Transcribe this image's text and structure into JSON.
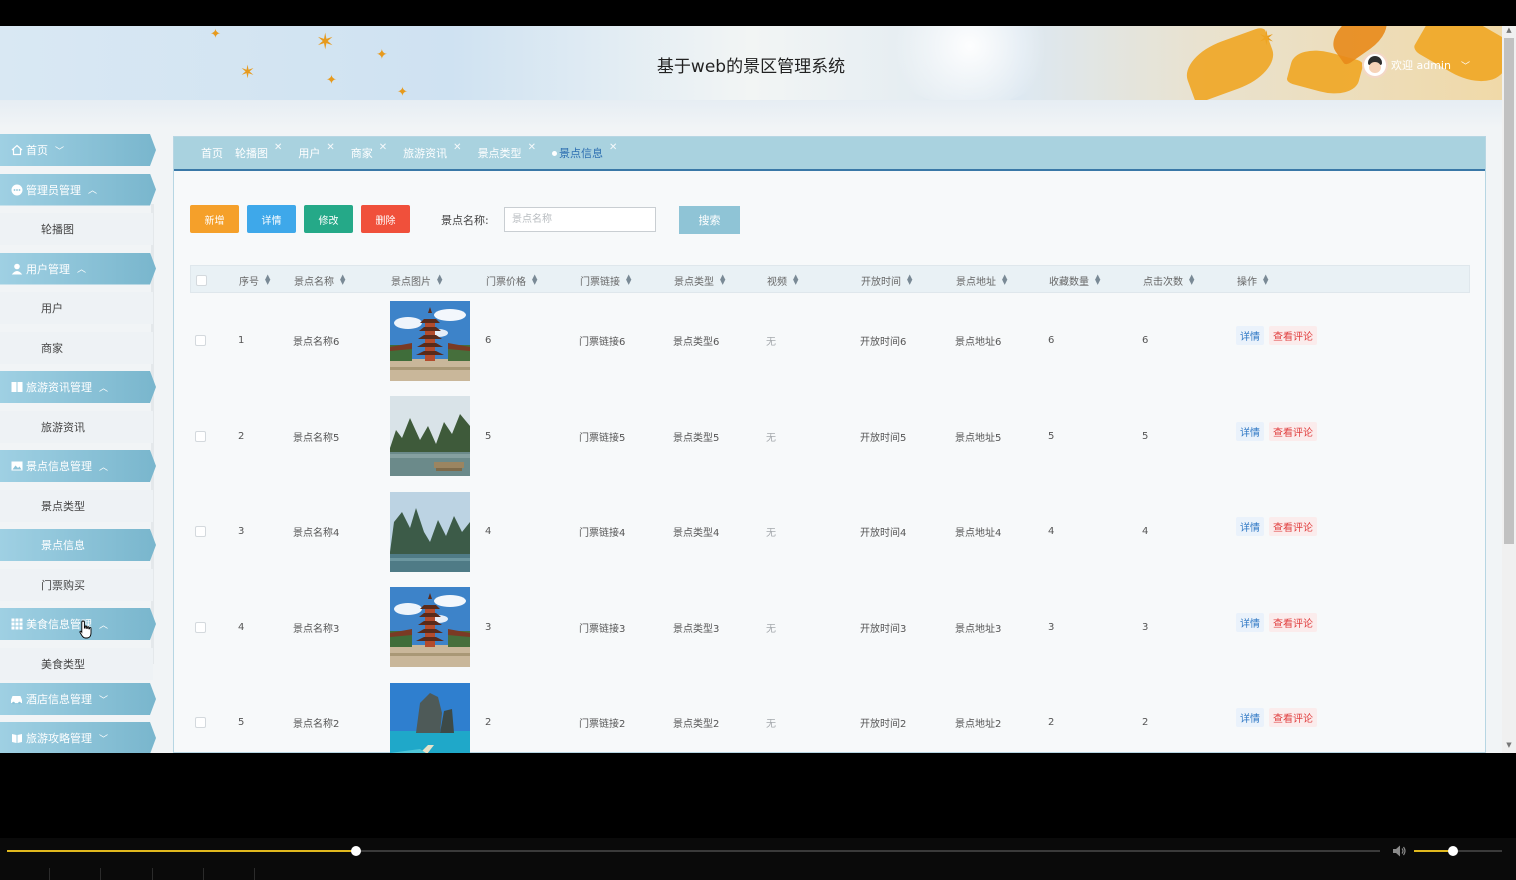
{
  "header": {
    "title": "基于web的景区管理系统",
    "welcome": "欢迎 admin"
  },
  "sidebar": {
    "items": [
      {
        "type": "group",
        "label": "首页",
        "icon": "home-icon",
        "caret": "⌄"
      },
      {
        "type": "group",
        "label": "管理员管理",
        "icon": "chat-icon",
        "caret": "^"
      },
      {
        "type": "sub",
        "label": "轮播图"
      },
      {
        "type": "group",
        "label": "用户管理",
        "icon": "user-icon",
        "caret": "^"
      },
      {
        "type": "sub",
        "label": "用户"
      },
      {
        "type": "sub",
        "label": "商家"
      },
      {
        "type": "group",
        "label": "旅游资讯管理",
        "icon": "columns-icon",
        "caret": "^"
      },
      {
        "type": "sub",
        "label": "旅游资讯"
      },
      {
        "type": "group",
        "label": "景点信息管理",
        "icon": "picture-icon",
        "caret": "^"
      },
      {
        "type": "sub",
        "label": "景点类型"
      },
      {
        "type": "sub",
        "label": "景点信息",
        "active": true
      },
      {
        "type": "sub",
        "label": "门票购买"
      },
      {
        "type": "group",
        "label": "美食信息管理",
        "icon": "grid-icon",
        "caret": "^"
      },
      {
        "type": "sub",
        "label": "美食类型"
      },
      {
        "type": "group",
        "label": "酒店信息管理",
        "icon": "car-icon",
        "caret": "⌄"
      },
      {
        "type": "group",
        "label": "旅游攻略管理",
        "icon": "book-icon",
        "caret": "⌄"
      }
    ]
  },
  "tabs": [
    {
      "label": "首页",
      "closable": false
    },
    {
      "label": "轮播图",
      "closable": true
    },
    {
      "label": "用户",
      "closable": true
    },
    {
      "label": "商家",
      "closable": true
    },
    {
      "label": "旅游资讯",
      "closable": true
    },
    {
      "label": "景点类型",
      "closable": true
    },
    {
      "label": "景点信息",
      "closable": true,
      "active": true
    }
  ],
  "toolbar": {
    "add": "新增",
    "detail": "详情",
    "edit": "修改",
    "delete": "删除",
    "search_label": "景点名称:",
    "search_placeholder": "景点名称",
    "search_button": "搜索"
  },
  "table": {
    "columns": [
      "序号",
      "景点名称",
      "景点图片",
      "门票价格",
      "门票链接",
      "景点类型",
      "视频",
      "开放时间",
      "景点地址",
      "收藏数量",
      "点击次数",
      "操作"
    ],
    "rows": [
      {
        "index": "1",
        "name": "景点名称6",
        "image": "pagoda",
        "price": "6",
        "link": "门票链接6",
        "type": "景点类型6",
        "video": "无",
        "open": "开放时间6",
        "address": "景点地址6",
        "fav": "6",
        "clicks": "6"
      },
      {
        "index": "2",
        "name": "景点名称5",
        "image": "karst-lake",
        "price": "5",
        "link": "门票链接5",
        "type": "景点类型5",
        "video": "无",
        "open": "开放时间5",
        "address": "景点地址5",
        "fav": "5",
        "clicks": "5"
      },
      {
        "index": "3",
        "name": "景点名称4",
        "image": "karst-river",
        "price": "4",
        "link": "门票链接4",
        "type": "景点类型4",
        "video": "无",
        "open": "开放时间4",
        "address": "景点地址4",
        "fav": "4",
        "clicks": "4"
      },
      {
        "index": "4",
        "name": "景点名称3",
        "image": "pagoda",
        "price": "3",
        "link": "门票链接3",
        "type": "景点类型3",
        "video": "无",
        "open": "开放时间3",
        "address": "景点地址3",
        "fav": "3",
        "clicks": "3"
      },
      {
        "index": "5",
        "name": "景点名称2",
        "image": "sea-cliff",
        "price": "2",
        "link": "门票链接2",
        "type": "景点类型2",
        "video": "无",
        "open": "开放时间2",
        "address": "景点地址2",
        "fav": "2",
        "clicks": "2"
      }
    ],
    "actions": {
      "detail": "详情",
      "comment": "查看评论"
    }
  },
  "player": {
    "progress": 0.254,
    "volume": 0.44
  },
  "colors": {
    "accent": "#79b6cd",
    "tab_bar": "#a9d2df",
    "add": "#f5a02a",
    "detail": "#3ea8ea",
    "edit": "#25a988",
    "delete": "#f0503b",
    "player_accent": "#e0b81e"
  }
}
